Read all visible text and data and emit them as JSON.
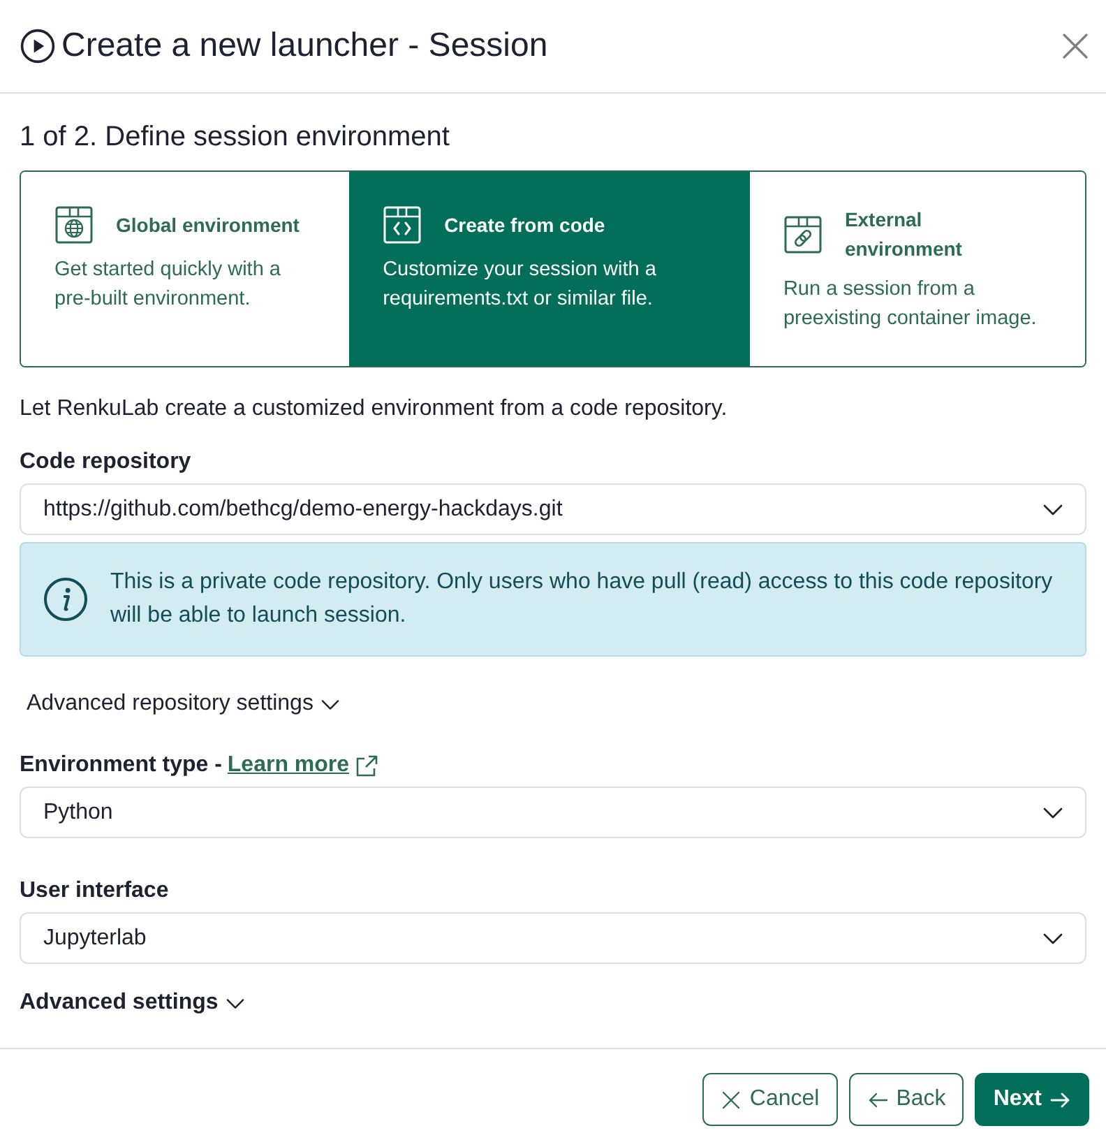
{
  "dialog": {
    "title": "Create a new launcher - Session"
  },
  "step_title": "1 of 2. Define session environment",
  "environment_options": [
    {
      "kind": "global",
      "title": "Global environment",
      "description": "Get started quickly with a pre-built environment.",
      "selected": false
    },
    {
      "kind": "code",
      "title": "Create from code",
      "description": "Customize your session with a requirements.txt or similar file.",
      "selected": true
    },
    {
      "kind": "external",
      "title": "External environment",
      "description": "Run a session from a preexisting container image.",
      "selected": false
    }
  ],
  "intro": "Let RenkuLab create a customized environment from a code repository.",
  "code_repository": {
    "label": "Code repository",
    "value": "https://github.com/bethcg/demo-energy-hackdays.git"
  },
  "alert": {
    "text": "This is a private code repository. Only users who have pull (read) access to this code repository will be able to launch session."
  },
  "advanced_repository_settings": {
    "label": "Advanced repository settings",
    "expanded": false
  },
  "environment_type": {
    "label": "Environment type -",
    "link": "Learn more",
    "value": "Python"
  },
  "user_interface": {
    "label": "User interface",
    "value": "Jupyterlab"
  },
  "advanced_settings": {
    "label": "Advanced settings",
    "expanded": false
  },
  "buttons": [
    {
      "kind": "cancel",
      "label": "Cancel"
    },
    {
      "kind": "back",
      "label": "Back"
    },
    {
      "kind": "next",
      "label": "Next"
    }
  ]
}
